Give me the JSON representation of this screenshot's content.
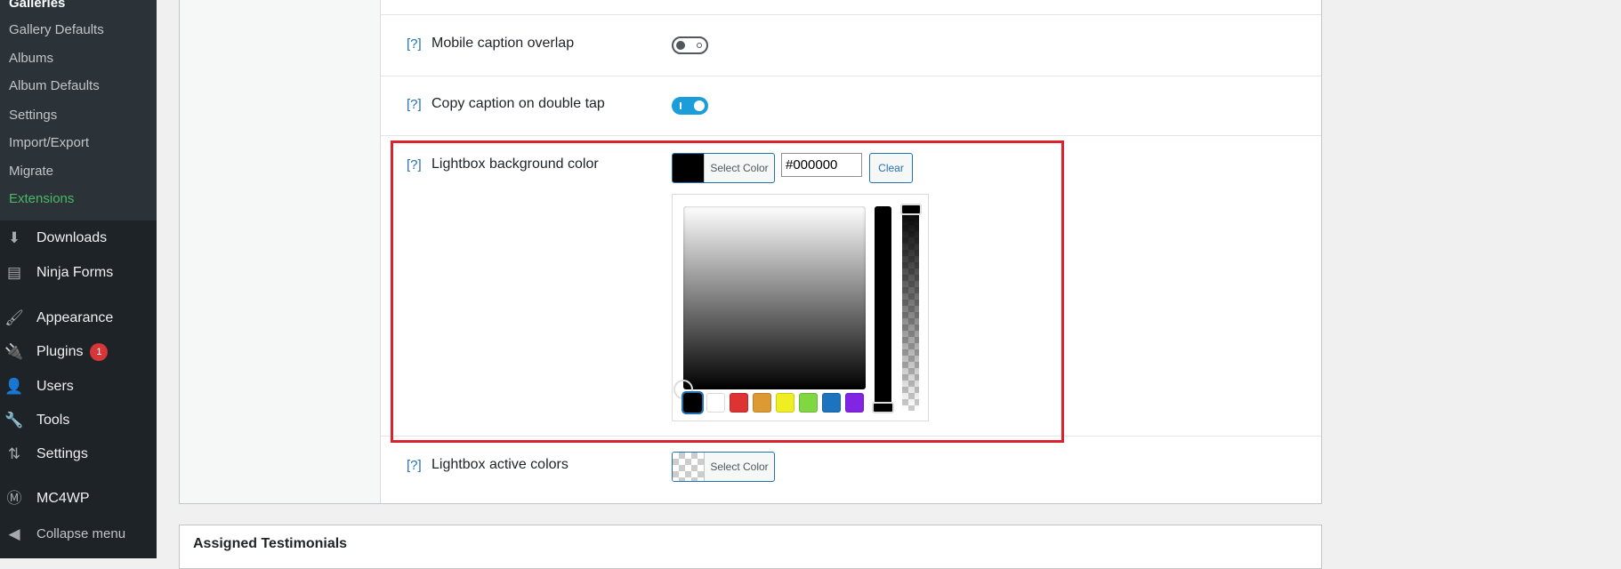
{
  "sidebar": {
    "submenu": [
      "Galleries",
      "Gallery Defaults",
      "Albums",
      "Album Defaults",
      "Settings",
      "Import/Export",
      "Migrate",
      "Extensions"
    ],
    "menu": [
      {
        "label": "Downloads",
        "icon": "download-icon"
      },
      {
        "label": "Ninja Forms",
        "icon": "forms-icon"
      },
      {
        "label": "Appearance",
        "icon": "paintbrush-icon"
      },
      {
        "label": "Plugins",
        "icon": "plugin-icon",
        "badge": "1"
      },
      {
        "label": "Users",
        "icon": "user-icon"
      },
      {
        "label": "Tools",
        "icon": "wrench-icon"
      },
      {
        "label": "Settings",
        "icon": "settings-icon"
      },
      {
        "label": "MC4WP",
        "icon": "mc4wp-icon"
      }
    ],
    "collapse": "Collapse menu"
  },
  "settings": {
    "help": "[?]",
    "mobile_caption_overlap": {
      "label": "Mobile caption overlap",
      "enabled": false
    },
    "copy_caption": {
      "label": "Copy caption on double tap",
      "enabled": true
    },
    "lightbox_bg": {
      "label": "Lightbox background color",
      "select": "Select Color",
      "value": "#000000",
      "clear": "Clear",
      "swatch": "#000000"
    },
    "palette": [
      "#000000",
      "#ffffff",
      "#dd3333",
      "#dd9933",
      "#eeee22",
      "#81d742",
      "#1e73be",
      "#8224e3"
    ],
    "lightbox_active": {
      "label": "Lightbox active colors",
      "select": "Select Color"
    }
  },
  "testimonials": {
    "title": "Assigned Testimonials"
  },
  "colors": {
    "highlight": "#d92430",
    "accent": "#2271b1",
    "toggle_on": "#1a9dd8"
  }
}
